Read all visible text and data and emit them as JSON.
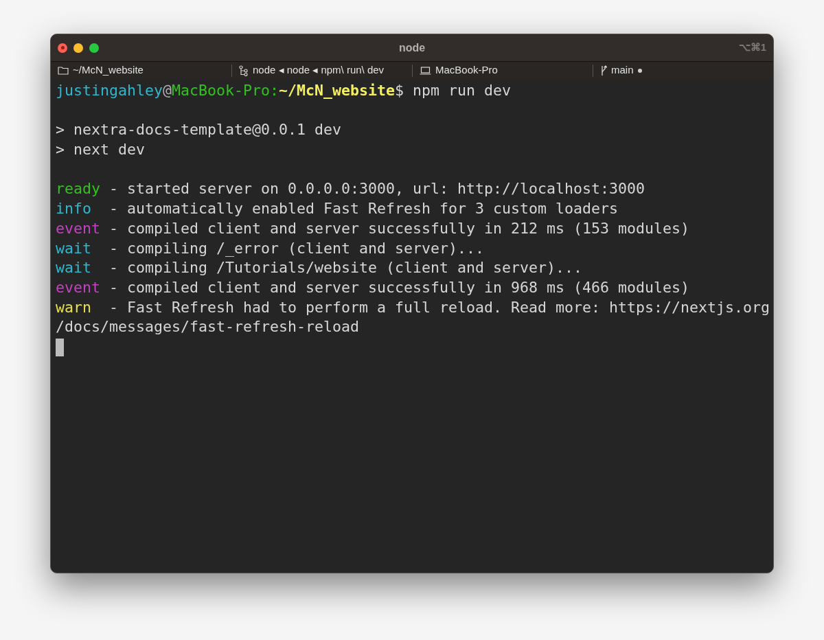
{
  "window": {
    "title": "node",
    "shortcut": "⌥⌘1"
  },
  "status_bar": [
    {
      "kind": "folder",
      "label": "~/McN_website"
    },
    {
      "kind": "process",
      "label": "node ◂ node ◂ npm\\ run\\ dev"
    },
    {
      "kind": "host",
      "label": "MacBook-Pro"
    },
    {
      "kind": "branch",
      "label": "main",
      "modified": true
    }
  ],
  "terminal": {
    "blocks": [
      [
        [
          {
            "text": "justingahley",
            "color": "#2cb8cf"
          },
          {
            "text": "@",
            "color": "#b0b0b0"
          },
          {
            "text": "MacBook-Pro:",
            "color": "#33c11f"
          },
          {
            "text": "~/McN_website",
            "color": "#f4f05c",
            "bold": true
          },
          {
            "text": "$ npm run dev",
            "color": "#d6d6d6"
          }
        ]
      ],
      [
        [
          {
            "text": "> nextra-docs-template@0.0.1 dev",
            "color": "#d6d6d6"
          }
        ],
        [
          {
            "text": "> next dev",
            "color": "#d6d6d6"
          }
        ]
      ],
      [
        [
          {
            "text": "ready",
            "color": "#33c11f"
          },
          {
            "text": " - started server on 0.0.0.0:3000, url: http://localhost:3000",
            "color": "#d6d6d6"
          }
        ],
        [
          {
            "text": "info ",
            "color": "#2cb8cf"
          },
          {
            "text": " - automatically enabled Fast Refresh for 3 custom loaders",
            "color": "#d6d6d6"
          }
        ],
        [
          {
            "text": "event",
            "color": "#c540c5"
          },
          {
            "text": " - compiled client and server successfully in 212 ms (153 modules)",
            "color": "#d6d6d6"
          }
        ],
        [
          {
            "text": "wait ",
            "color": "#2cb8cf"
          },
          {
            "text": " - compiling /_error (client and server)...",
            "color": "#d6d6d6"
          }
        ],
        [
          {
            "text": "wait ",
            "color": "#2cb8cf"
          },
          {
            "text": " - compiling /Tutorials/website (client and server)...",
            "color": "#d6d6d6"
          }
        ],
        [
          {
            "text": "event",
            "color": "#c540c5"
          },
          {
            "text": " - compiled client and server successfully in 968 ms (466 modules)",
            "color": "#d6d6d6"
          }
        ],
        [
          {
            "text": "warn ",
            "color": "#e8e04a"
          },
          {
            "text": " - Fast Refresh had to perform a full reload. Read more: https://nextjs.org",
            "color": "#d6d6d6"
          }
        ],
        [
          {
            "text": "/docs/messages/fast-refresh-reload",
            "color": "#d6d6d6"
          }
        ]
      ]
    ],
    "cursor": true
  }
}
